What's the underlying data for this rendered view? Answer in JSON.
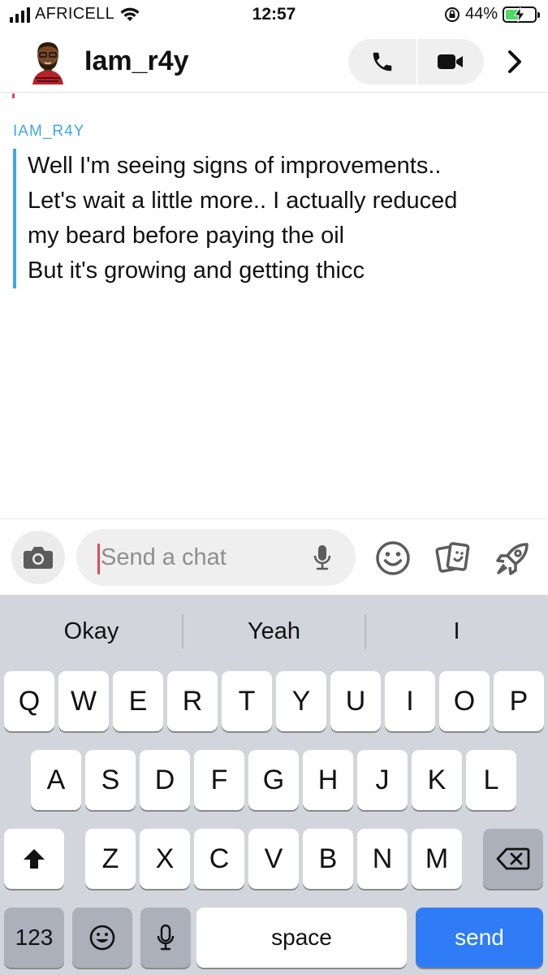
{
  "status_bar": {
    "carrier": "AFRICELL",
    "time": "12:57",
    "battery_percent": "44%",
    "battery_level": 0.44,
    "icons": [
      "signal-bars-icon",
      "wifi-icon",
      "rotation-lock-icon",
      "battery-charging-icon"
    ]
  },
  "header": {
    "contact_name": "Iam_r4y",
    "buttons": [
      "voice-call",
      "video-call",
      "more-chevron"
    ]
  },
  "chat": {
    "sender": "IAM_R4Y",
    "lines": [
      "Well I'm seeing signs of improvements..",
      "Let's wait a little more.. I actually reduced",
      "my beard before paying the oil",
      "But it's growing and getting thicc"
    ]
  },
  "input": {
    "placeholder": "Send a chat",
    "icons": [
      "camera-icon",
      "microphone-icon",
      "emoji-icon",
      "cards-icon",
      "rocket-icon"
    ]
  },
  "keyboard": {
    "suggestions": [
      "Okay",
      "Yeah",
      "I"
    ],
    "row1": [
      "Q",
      "W",
      "E",
      "R",
      "T",
      "Y",
      "U",
      "I",
      "O",
      "P"
    ],
    "row2": [
      "A",
      "S",
      "D",
      "F",
      "G",
      "H",
      "J",
      "K",
      "L"
    ],
    "row3": [
      "Z",
      "X",
      "C",
      "V",
      "B",
      "N",
      "M"
    ],
    "numbers_label": "123",
    "space_label": "space",
    "send_label": "send"
  },
  "colors": {
    "accent_blue": "#3fa8e6",
    "cursor_red": "#e04b56",
    "send_key": "#2f7cf6",
    "keyboard_bg": "#d2d5db"
  }
}
